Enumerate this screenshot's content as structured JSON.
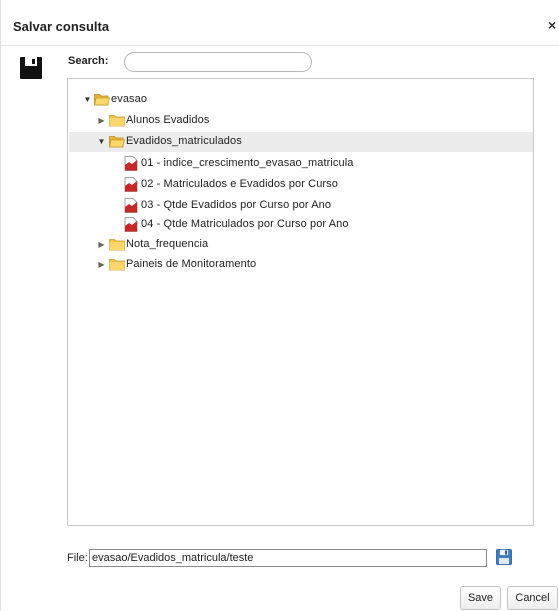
{
  "dialog": {
    "title": "Salvar consulta",
    "close_symbol": "×"
  },
  "search": {
    "label": "Search:",
    "value": "",
    "placeholder": ""
  },
  "tree": {
    "root": {
      "label": "evasao",
      "expanded": true
    },
    "folders": [
      {
        "label": "Alunos Evadidos",
        "expanded": false
      },
      {
        "label": "Evadidos_matriculados",
        "expanded": true,
        "selected": true
      },
      {
        "label": "Nota_frequencia",
        "expanded": false
      },
      {
        "label": "Paineis de Monitoramento",
        "expanded": false
      }
    ],
    "reports": [
      {
        "label": "01 - indice_crescimento_evasao_matricula"
      },
      {
        "label": "02 - Matriculados e Evadidos por Curso"
      },
      {
        "label": "03 - Qtde Evadidos por Curso por Ano"
      },
      {
        "label": "04 - Qtde Matriculados por Curso por Ano"
      }
    ]
  },
  "file": {
    "label": "File:",
    "value": "evasao/Evadidos_matricula/teste"
  },
  "buttons": {
    "save": "Save",
    "cancel": "Cancel"
  },
  "icons": {
    "title_save": "floppy-disk-icon",
    "folder": "folder-icon",
    "report": "report-file-icon",
    "file_save": "floppy-disk-icon"
  },
  "colors": {
    "folder": "#f5c542",
    "report_red": "#c62828",
    "selected_row": "#ececec"
  }
}
